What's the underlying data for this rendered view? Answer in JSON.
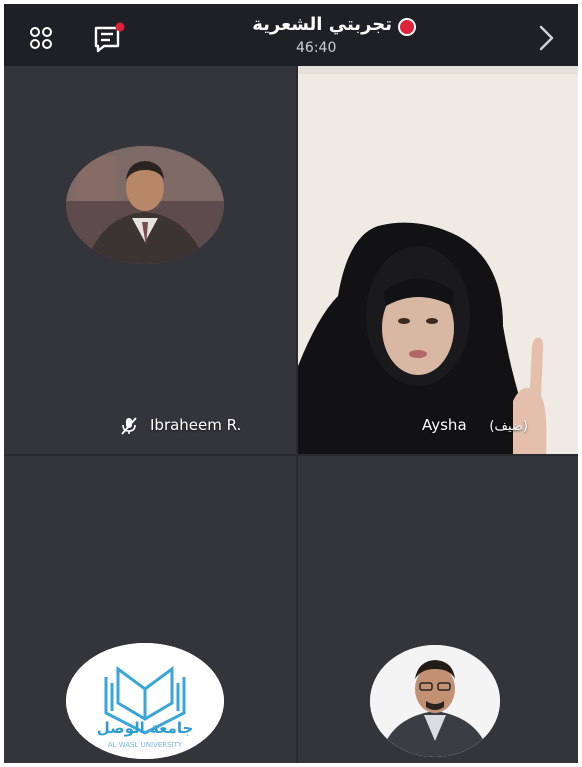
{
  "header": {
    "meeting_title": "تجربتي الشعرية",
    "timer": "46:40",
    "recording_color": "#e0213b",
    "icons": [
      "participants-icon",
      "chat-icon",
      "chevron-right-icon"
    ]
  },
  "participants": [
    {
      "name": "Ibraheem R.",
      "muted": true,
      "tile": "top-left"
    },
    {
      "name": "Aysha",
      "suffix": "(ضيف)",
      "tile": "top-right"
    },
    {
      "name": "",
      "tile": "bottom-left",
      "logo_text": "جامعة الوصل",
      "logo_subtext": "AL WASL UNIVERSITY"
    },
    {
      "name": "",
      "tile": "bottom-right"
    }
  ],
  "colors": {
    "topbar": "#1f2026",
    "tile_bg": "#34353b",
    "badge": "#e0213b",
    "logo_blue": "#3aa6d8"
  }
}
